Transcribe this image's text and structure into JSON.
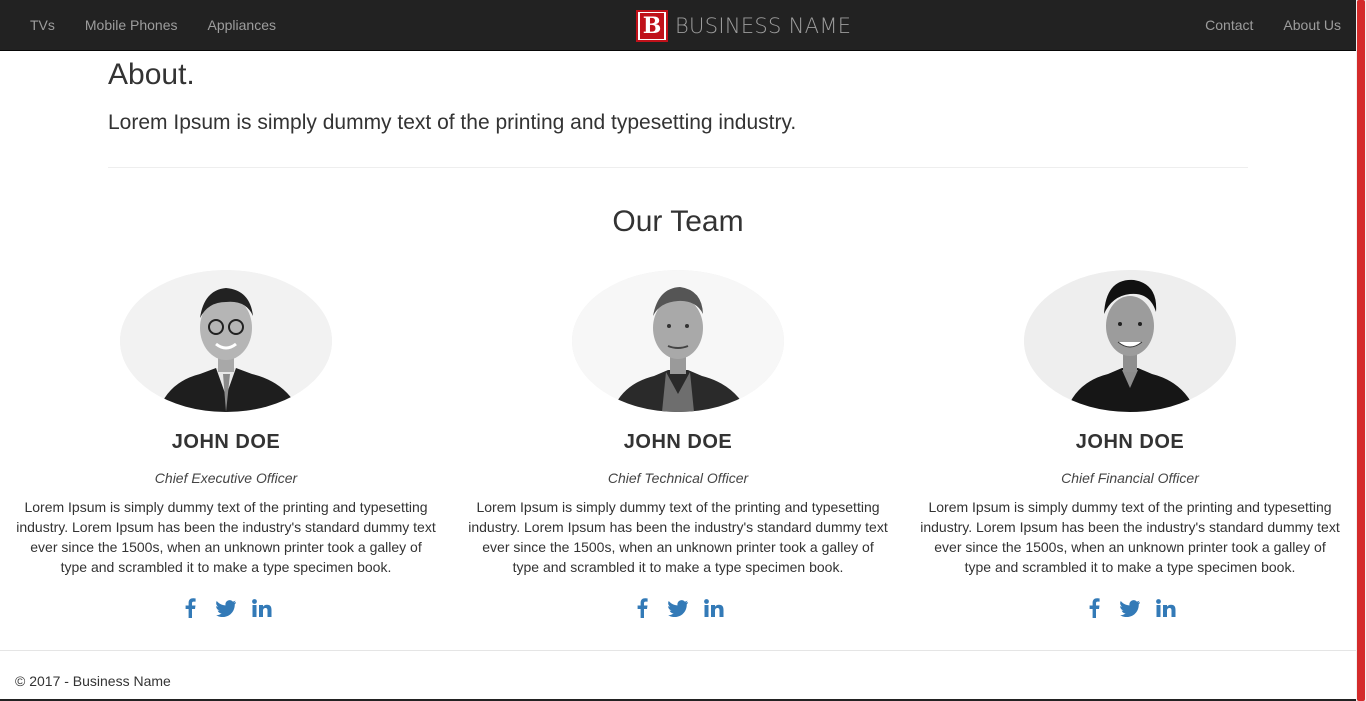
{
  "nav": {
    "left": [
      {
        "label": "TVs"
      },
      {
        "label": "Mobile Phones"
      },
      {
        "label": "Appliances"
      }
    ],
    "brand": {
      "logo_letter": "B",
      "text": "BUSINESS NAME"
    },
    "right": [
      {
        "label": "Contact"
      },
      {
        "label": "About Us"
      }
    ]
  },
  "about": {
    "title": "About.",
    "lead": "Lorem Ipsum is simply dummy text of the printing and typesetting industry."
  },
  "team": {
    "heading": "Our Team",
    "members": [
      {
        "name": "JOHN DOE",
        "role": "Chief Executive Officer",
        "bio": "Lorem Ipsum is simply dummy text of the printing and typesetting industry. Lorem Ipsum has been the industry's standard dummy text ever since the 1500s, when an unknown printer took a galley of type and scrambled it to make a type specimen book."
      },
      {
        "name": "JOHN DOE",
        "role": "Chief Technical Officer",
        "bio": "Lorem Ipsum is simply dummy text of the printing and typesetting industry. Lorem Ipsum has been the industry's standard dummy text ever since the 1500s, when an unknown printer took a galley of type and scrambled it to make a type specimen book."
      },
      {
        "name": "JOHN DOE",
        "role": "Chief Financial Officer",
        "bio": "Lorem Ipsum is simply dummy text of the printing and typesetting industry. Lorem Ipsum has been the industry's standard dummy text ever since the 1500s, when an unknown printer took a galley of type and scrambled it to make a type specimen book."
      }
    ],
    "social_icons": [
      "facebook-icon",
      "twitter-icon",
      "linkedin-icon"
    ]
  },
  "footer": {
    "text": "© 2017 - Business Name"
  },
  "colors": {
    "navbar": "#222222",
    "nav_text": "#9d9d9d",
    "brand_red": "#c0111a",
    "social_blue": "#337ab7",
    "scroll_thumb": "#d42b2b"
  }
}
